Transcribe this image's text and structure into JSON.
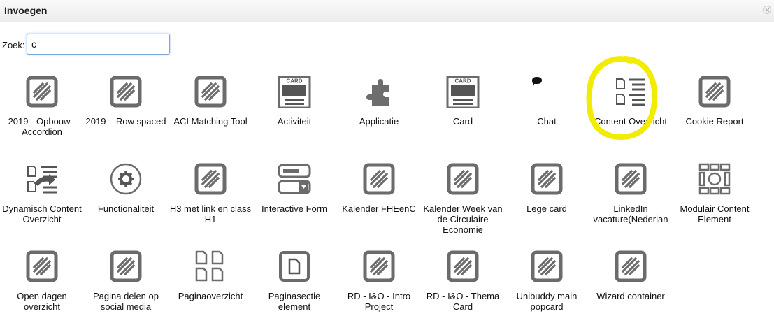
{
  "dialog": {
    "title": "Invoegen"
  },
  "search": {
    "label": "Zoek:",
    "value": "c"
  },
  "accent": {
    "highlight": "#f2ec00",
    "icon": "#6b6b6b"
  },
  "tiles": [
    {
      "label": "2019 - Opbouw - Accordion",
      "icon": "block-icon"
    },
    {
      "label": "2019 – Row spaced",
      "icon": "block-icon"
    },
    {
      "label": "ACI Matching Tool",
      "icon": "block-icon"
    },
    {
      "label": "Activiteit",
      "icon": "card-icon",
      "icon_text": "CARD"
    },
    {
      "label": "Applicatie",
      "icon": "puzzle-icon"
    },
    {
      "label": "Card",
      "icon": "card-icon",
      "icon_text": "CARD"
    },
    {
      "label": "Chat",
      "icon": "chat-icon"
    },
    {
      "label": "Content Overzicht",
      "icon": "content-list-icon"
    },
    {
      "label": "Cookie Report",
      "icon": "block-icon"
    },
    {
      "label": "Dynamisch Content Overzicht",
      "icon": "dynamic-content-icon"
    },
    {
      "label": "Functionaliteit",
      "icon": "gear-icon"
    },
    {
      "label": "H3 met link en class H1",
      "icon": "block-icon"
    },
    {
      "label": "Interactive Form",
      "icon": "form-icon"
    },
    {
      "label": "Kalender FHEenC",
      "icon": "block-icon"
    },
    {
      "label": "Kalender Week van de Circulaire Economie",
      "icon": "block-icon"
    },
    {
      "label": "Lege card",
      "icon": "block-icon"
    },
    {
      "label": "LinkedIn vacature(Nederlan",
      "icon": "block-icon"
    },
    {
      "label": "Modulair Content Element",
      "icon": "modular-icon"
    },
    {
      "label": "Open dagen overzicht",
      "icon": "block-icon"
    },
    {
      "label": "Pagina delen op social media",
      "icon": "block-icon"
    },
    {
      "label": "Paginaoverzicht",
      "icon": "pages-grid-icon"
    },
    {
      "label": "Paginasectie element",
      "icon": "page-section-icon"
    },
    {
      "label": "RD - I&O - Intro Project",
      "icon": "block-icon"
    },
    {
      "label": "RD - I&O - Thema Card",
      "icon": "block-icon"
    },
    {
      "label": "Unibuddy main popcard",
      "icon": "block-icon"
    },
    {
      "label": "Wizard container",
      "icon": "block-icon"
    }
  ]
}
